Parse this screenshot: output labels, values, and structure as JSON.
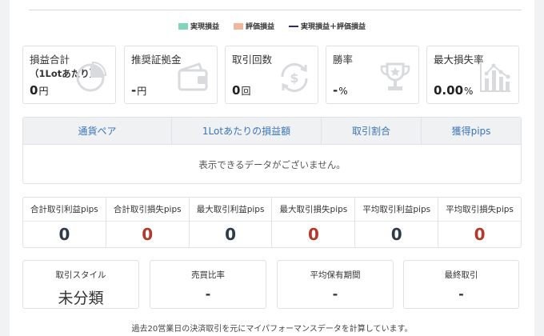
{
  "legend": {
    "realized": {
      "label": "実現損益",
      "color": "#7fd6b8"
    },
    "unrealized": {
      "label": "評価損益",
      "color": "#f3b59c"
    },
    "combined": {
      "label": "実現損益＋評価損益",
      "color": "#2c2f5e"
    }
  },
  "stats": {
    "pnl": {
      "label": "損益合計",
      "sublabel": "（1Lotあたり）",
      "value": "0",
      "unit": "円",
      "icon": "pie-chart-icon"
    },
    "margin": {
      "label": "推奨証拠金",
      "value": "-",
      "unit": "円",
      "icon": "wallet-icon"
    },
    "trades": {
      "label": "取引回数",
      "value": "0",
      "unit": "回",
      "icon": "currency-cycle-icon"
    },
    "winrate": {
      "label": "勝率",
      "value": "-",
      "unit": "%",
      "icon": "trophy-icon"
    },
    "drawdown": {
      "label": "最大損失率",
      "value": "0.00",
      "unit": "%",
      "icon": "bar-chart-icon"
    }
  },
  "table": {
    "columns": [
      "通貨ペア",
      "1Lotあたりの損益額",
      "取引割合",
      "獲得pips"
    ],
    "empty_message": "表示できるデータがございません。"
  },
  "pips": {
    "total_profit": {
      "label": "合計取引利益pips",
      "value": "0"
    },
    "total_loss": {
      "label": "合計取引損失pips",
      "value": "0"
    },
    "max_profit": {
      "label": "最大取引利益pips",
      "value": "0"
    },
    "max_loss": {
      "label": "最大取引損失pips",
      "value": "0"
    },
    "avg_profit": {
      "label": "平均取引利益pips",
      "value": "0"
    },
    "avg_loss": {
      "label": "平均取引損失pips",
      "value": "0"
    }
  },
  "cards": {
    "style": {
      "label": "取引スタイル",
      "value": "未分類"
    },
    "ratio": {
      "label": "売買比率",
      "value": "-"
    },
    "holding": {
      "label": "平均保有期間",
      "value": "-"
    },
    "last": {
      "label": "最終取引",
      "value": "-"
    }
  },
  "footer": "過去20営業日の決済取引を元にマイパフォーマンスデータを計算しています。"
}
